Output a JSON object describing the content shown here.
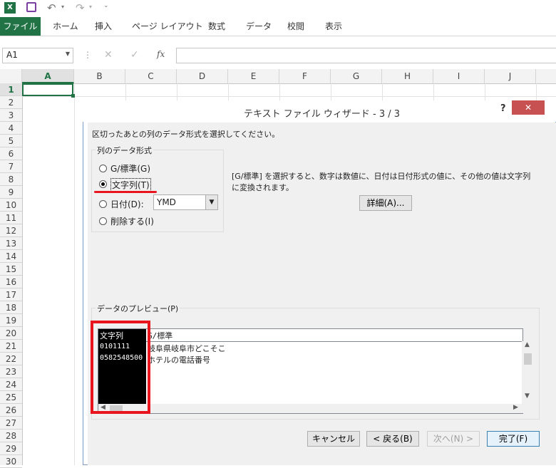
{
  "quick_access": {
    "excel_icon": "excel-icon",
    "save_icon": "save-icon",
    "undo_icon": "undo-icon",
    "redo_icon": "redo-icon",
    "customize_icon": "customize-icon"
  },
  "ribbon": {
    "tabs": [
      "ファイル",
      "ホーム",
      "挿入",
      "ページ レイアウト",
      "数式",
      "データ",
      "校閲",
      "表示"
    ]
  },
  "formula_bar": {
    "name_box": "A1",
    "fx_label": "fx",
    "value": ""
  },
  "grid": {
    "columns": [
      "A",
      "B",
      "C",
      "D",
      "E",
      "F",
      "G",
      "H",
      "I",
      "J"
    ],
    "rows": [
      "1",
      "2",
      "3",
      "4",
      "5",
      "6",
      "7",
      "8",
      "9",
      "10",
      "11",
      "12",
      "13",
      "14",
      "15",
      "16",
      "17",
      "18",
      "19",
      "20",
      "21",
      "22",
      "23",
      "24",
      "25",
      "26",
      "27",
      "28",
      "29",
      "30"
    ]
  },
  "dialog": {
    "title": "テキスト ファイル ウィザード - 3 / 3",
    "help_label": "?",
    "close_label": "✕",
    "instruction": "区切ったあとの列のデータ形式を選択してください。",
    "group_label": "列のデータ形式",
    "options": {
      "general": "G/標準(G)",
      "text": "文字列(T)",
      "date": "日付(D):",
      "skip": "削除する(I)"
    },
    "date_format": "YMD",
    "description": "[G/標準] を選択すると、数字は数値に、日付は日付形式の値に、その他の値は文字列に変換されます。",
    "advanced_button": "詳細(A)...",
    "preview_label": "データのプレビュー(P)",
    "preview": {
      "headers": [
        "文字列",
        "G/標準"
      ],
      "rows": [
        [
          "0101111",
          "岐阜県岐阜市どこそこ"
        ],
        [
          "0582548500",
          "ホテルの電話番号"
        ]
      ]
    },
    "buttons": {
      "cancel": "キャンセル",
      "back": "< 戻る(B)",
      "next": "次へ(N) >",
      "finish": "完了(F)"
    }
  },
  "colors": {
    "excel_green": "#217346",
    "highlight_red": "#e8141e"
  }
}
